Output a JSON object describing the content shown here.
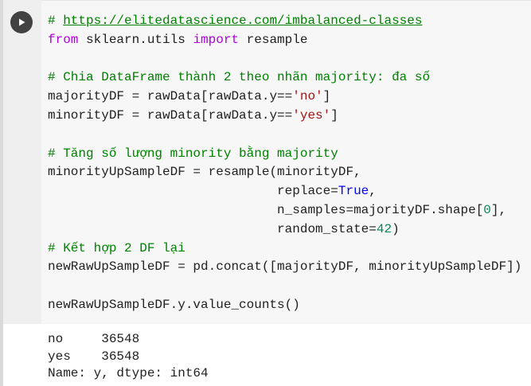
{
  "cell": {
    "run_icon": "play-icon",
    "code_lines": [
      [
        {
          "t": "# ",
          "c": "cm"
        },
        {
          "t": "https://elitedatascience.com/imbalanced-classes",
          "c": "lnk"
        }
      ],
      [
        {
          "t": "from",
          "c": "kw"
        },
        {
          "t": " sklearn.utils ",
          "c": ""
        },
        {
          "t": "import",
          "c": "kw"
        },
        {
          "t": " resample",
          "c": ""
        }
      ],
      [],
      [
        {
          "t": "# Chia DataFrame thành 2 theo nhãn majority: đa số",
          "c": "cm"
        }
      ],
      [
        {
          "t": "majorityDF = rawData[rawData.y==",
          "c": ""
        },
        {
          "t": "'no'",
          "c": "st"
        },
        {
          "t": "]",
          "c": ""
        }
      ],
      [
        {
          "t": "minorityDF = rawData[rawData.y==",
          "c": ""
        },
        {
          "t": "'yes'",
          "c": "st"
        },
        {
          "t": "]",
          "c": ""
        }
      ],
      [],
      [
        {
          "t": "# Tăng số lượng minority bằng majority",
          "c": "cm"
        }
      ],
      [
        {
          "t": "minorityUpSampleDF = resample(minorityDF,",
          "c": ""
        }
      ],
      [
        {
          "t": "                              replace=",
          "c": ""
        },
        {
          "t": "True",
          "c": "bl"
        },
        {
          "t": ",",
          "c": ""
        }
      ],
      [
        {
          "t": "                              n_samples=majorityDF.shape[",
          "c": ""
        },
        {
          "t": "0",
          "c": "nm"
        },
        {
          "t": "],",
          "c": ""
        }
      ],
      [
        {
          "t": "                              random_state=",
          "c": ""
        },
        {
          "t": "42",
          "c": "nm"
        },
        {
          "t": ")",
          "c": ""
        }
      ],
      [
        {
          "t": "# Kết hợp 2 DF lại",
          "c": "cm"
        }
      ],
      [
        {
          "t": "newRawUpSampleDF = pd.concat([majorityDF, minorityUpSampleDF])",
          "c": ""
        }
      ],
      [],
      [
        {
          "t": "newRawUpSampleDF.y.value_counts()",
          "c": ""
        }
      ]
    ],
    "output_lines": [
      "no     36548",
      "yes    36548",
      "Name: y, dtype: int64"
    ]
  }
}
